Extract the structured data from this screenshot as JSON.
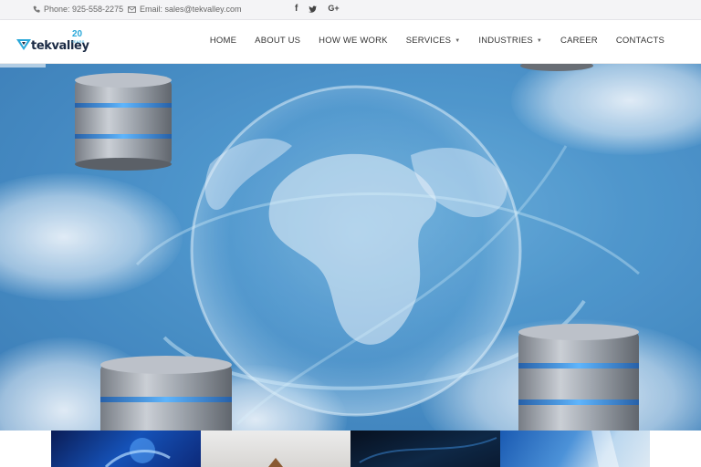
{
  "topbar": {
    "phone": "Phone: 925-558-2275",
    "email": "Email: sales@tekvalley.com",
    "social": [
      {
        "icon": "facebook-icon",
        "glyph": "f"
      },
      {
        "icon": "twitter-icon",
        "glyph": "t"
      },
      {
        "icon": "google-plus-icon",
        "glyph": "G+"
      }
    ]
  },
  "logo": {
    "name": "tekvalley",
    "badge_number": "20",
    "badge_text": "YEARS"
  },
  "nav": {
    "home": "HOME",
    "about": "ABOUT US",
    "how": "HOW WE WORK",
    "services": "SERVICES",
    "industries": "INDUSTRIES",
    "career": "CAREER",
    "contacts": "CONTACTS"
  },
  "colors": {
    "accent": "#2aa8d9",
    "logo_text": "#1b2a44",
    "hero_blue": "#3d8dc8"
  }
}
